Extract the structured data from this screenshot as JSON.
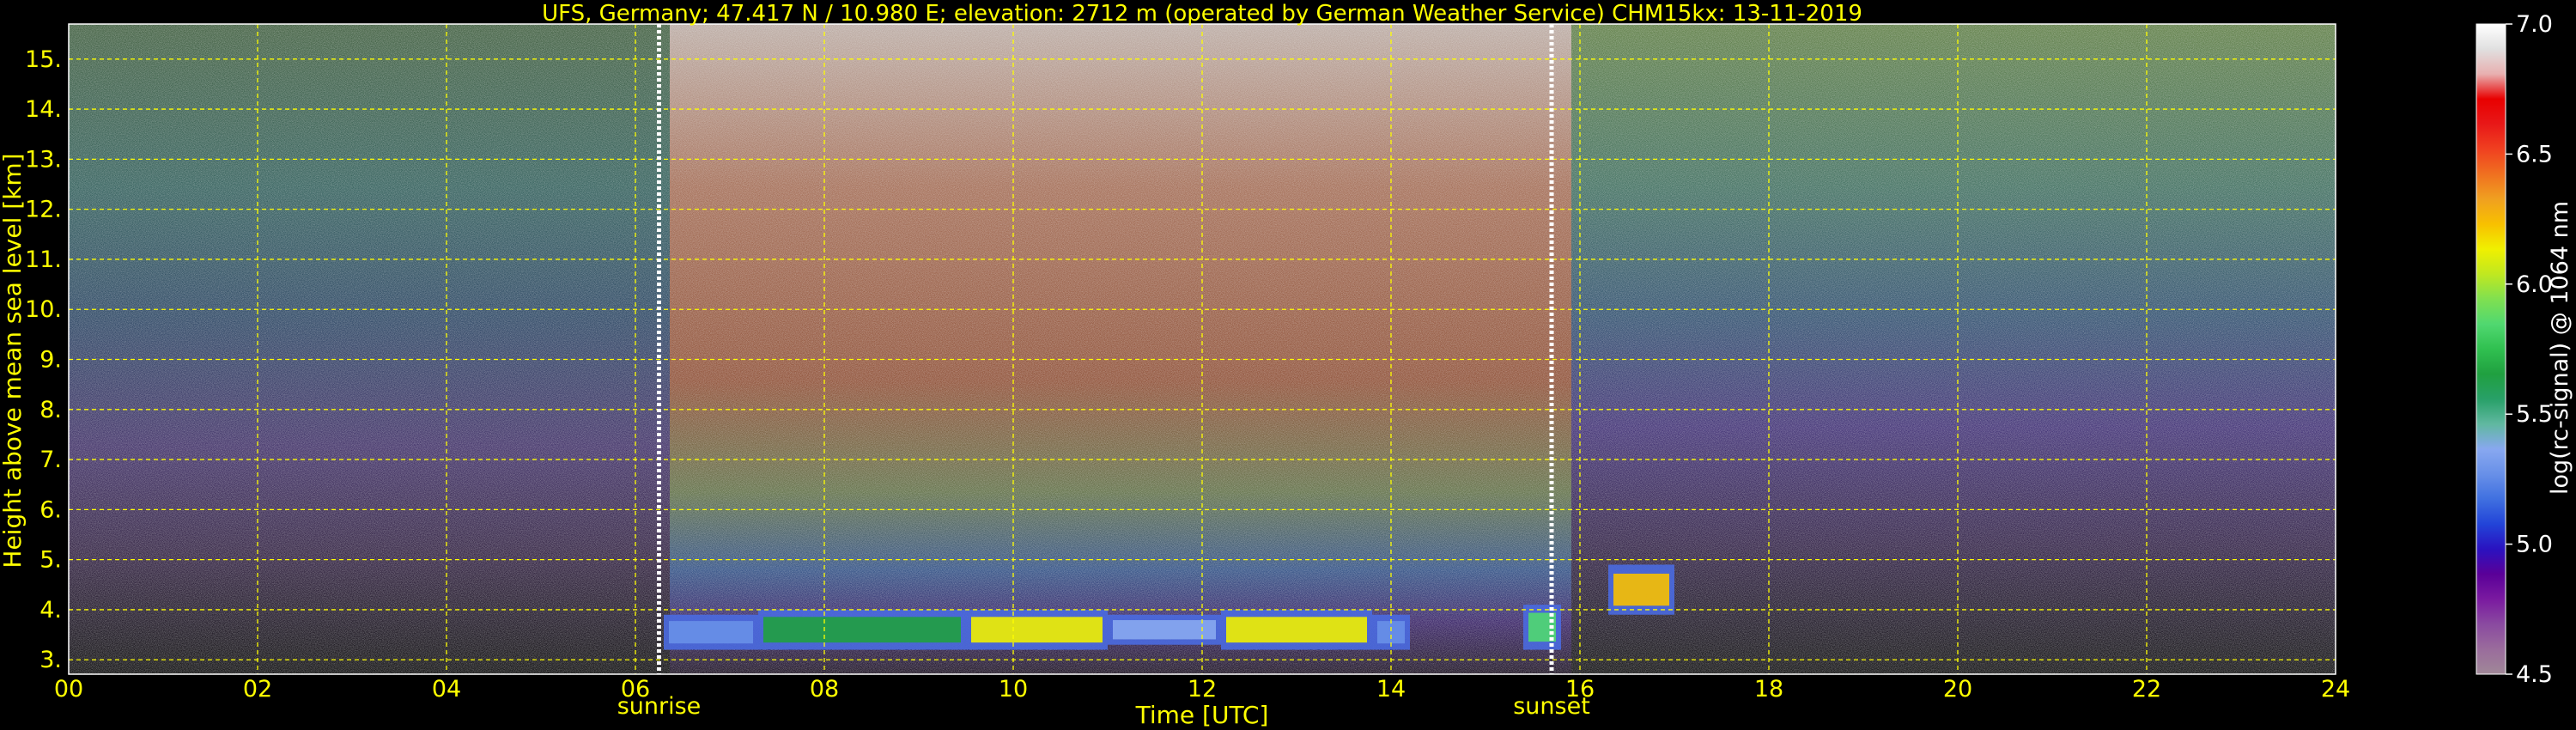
{
  "chart_data": {
    "type": "heatmap",
    "title": "UFS, Germany; 47.417 N / 10.980 E; elevation: 2712 m  (operated by German Weather Service)    CHM15kx: 13-11-2019",
    "xlabel": "Time [UTC]",
    "ylabel": "Height above mean sea level [km]",
    "xlim": [
      0,
      24
    ],
    "ylim": [
      2.712,
      15.7
    ],
    "x_ticks": [
      "00",
      "02",
      "04",
      "06",
      "08",
      "10",
      "12",
      "14",
      "16",
      "18",
      "20",
      "22",
      "24"
    ],
    "y_ticks": [
      "3.",
      "4.",
      "5.",
      "6.",
      "7.",
      "8.",
      "9.",
      "10.",
      "11.",
      "12.",
      "13.",
      "14.",
      "15."
    ],
    "grid": true,
    "events": [
      {
        "label": "sunrise",
        "time": 6.25
      },
      {
        "label": "sunset",
        "time": 15.7
      }
    ],
    "colorbar": {
      "label": "log(rc-signal) @ 1064 nm",
      "ticks": [
        "4.5",
        "5.0",
        "5.5",
        "6.0",
        "6.5",
        "7.0"
      ],
      "range": [
        4.5,
        7.0
      ],
      "colors": [
        "#a08898",
        "#9a6c9c",
        "#8a4aa0",
        "#7a1aa0",
        "#5a0098",
        "#2a12c0",
        "#2244d8",
        "#4070e0",
        "#6890e8",
        "#88a8f0",
        "#60b8a0",
        "#28a068",
        "#20a040",
        "#30c050",
        "#50d870",
        "#80e050",
        "#c0e820",
        "#f0f000",
        "#f8c000",
        "#f0a020",
        "#f07020",
        "#f04020",
        "#e81818",
        "#e80000",
        "#e8b0b0",
        "#e0e0e0",
        "#ffffff"
      ]
    },
    "cloud_layers": [
      {
        "start": 6.3,
        "end": 7.3,
        "base_km": 3.2,
        "top_km": 3.9,
        "intensity": 5.3
      },
      {
        "start": 7.3,
        "end": 9.5,
        "base_km": 3.2,
        "top_km": 4.0,
        "intensity": 5.7
      },
      {
        "start": 9.5,
        "end": 11.0,
        "base_km": 3.2,
        "top_km": 4.0,
        "intensity": 6.1
      },
      {
        "start": 11.0,
        "end": 12.2,
        "base_km": 3.3,
        "top_km": 3.9,
        "intensity": 5.4
      },
      {
        "start": 12.2,
        "end": 13.8,
        "base_km": 3.2,
        "top_km": 4.0,
        "intensity": 6.1
      },
      {
        "start": 13.8,
        "end": 14.2,
        "base_km": 3.2,
        "top_km": 3.9,
        "intensity": 5.3
      },
      {
        "start": 15.4,
        "end": 15.8,
        "base_km": 3.2,
        "top_km": 4.1,
        "intensity": 5.8
      },
      {
        "start": 16.3,
        "end": 17.0,
        "base_km": 3.9,
        "top_km": 4.9,
        "intensity": 6.2
      }
    ]
  }
}
